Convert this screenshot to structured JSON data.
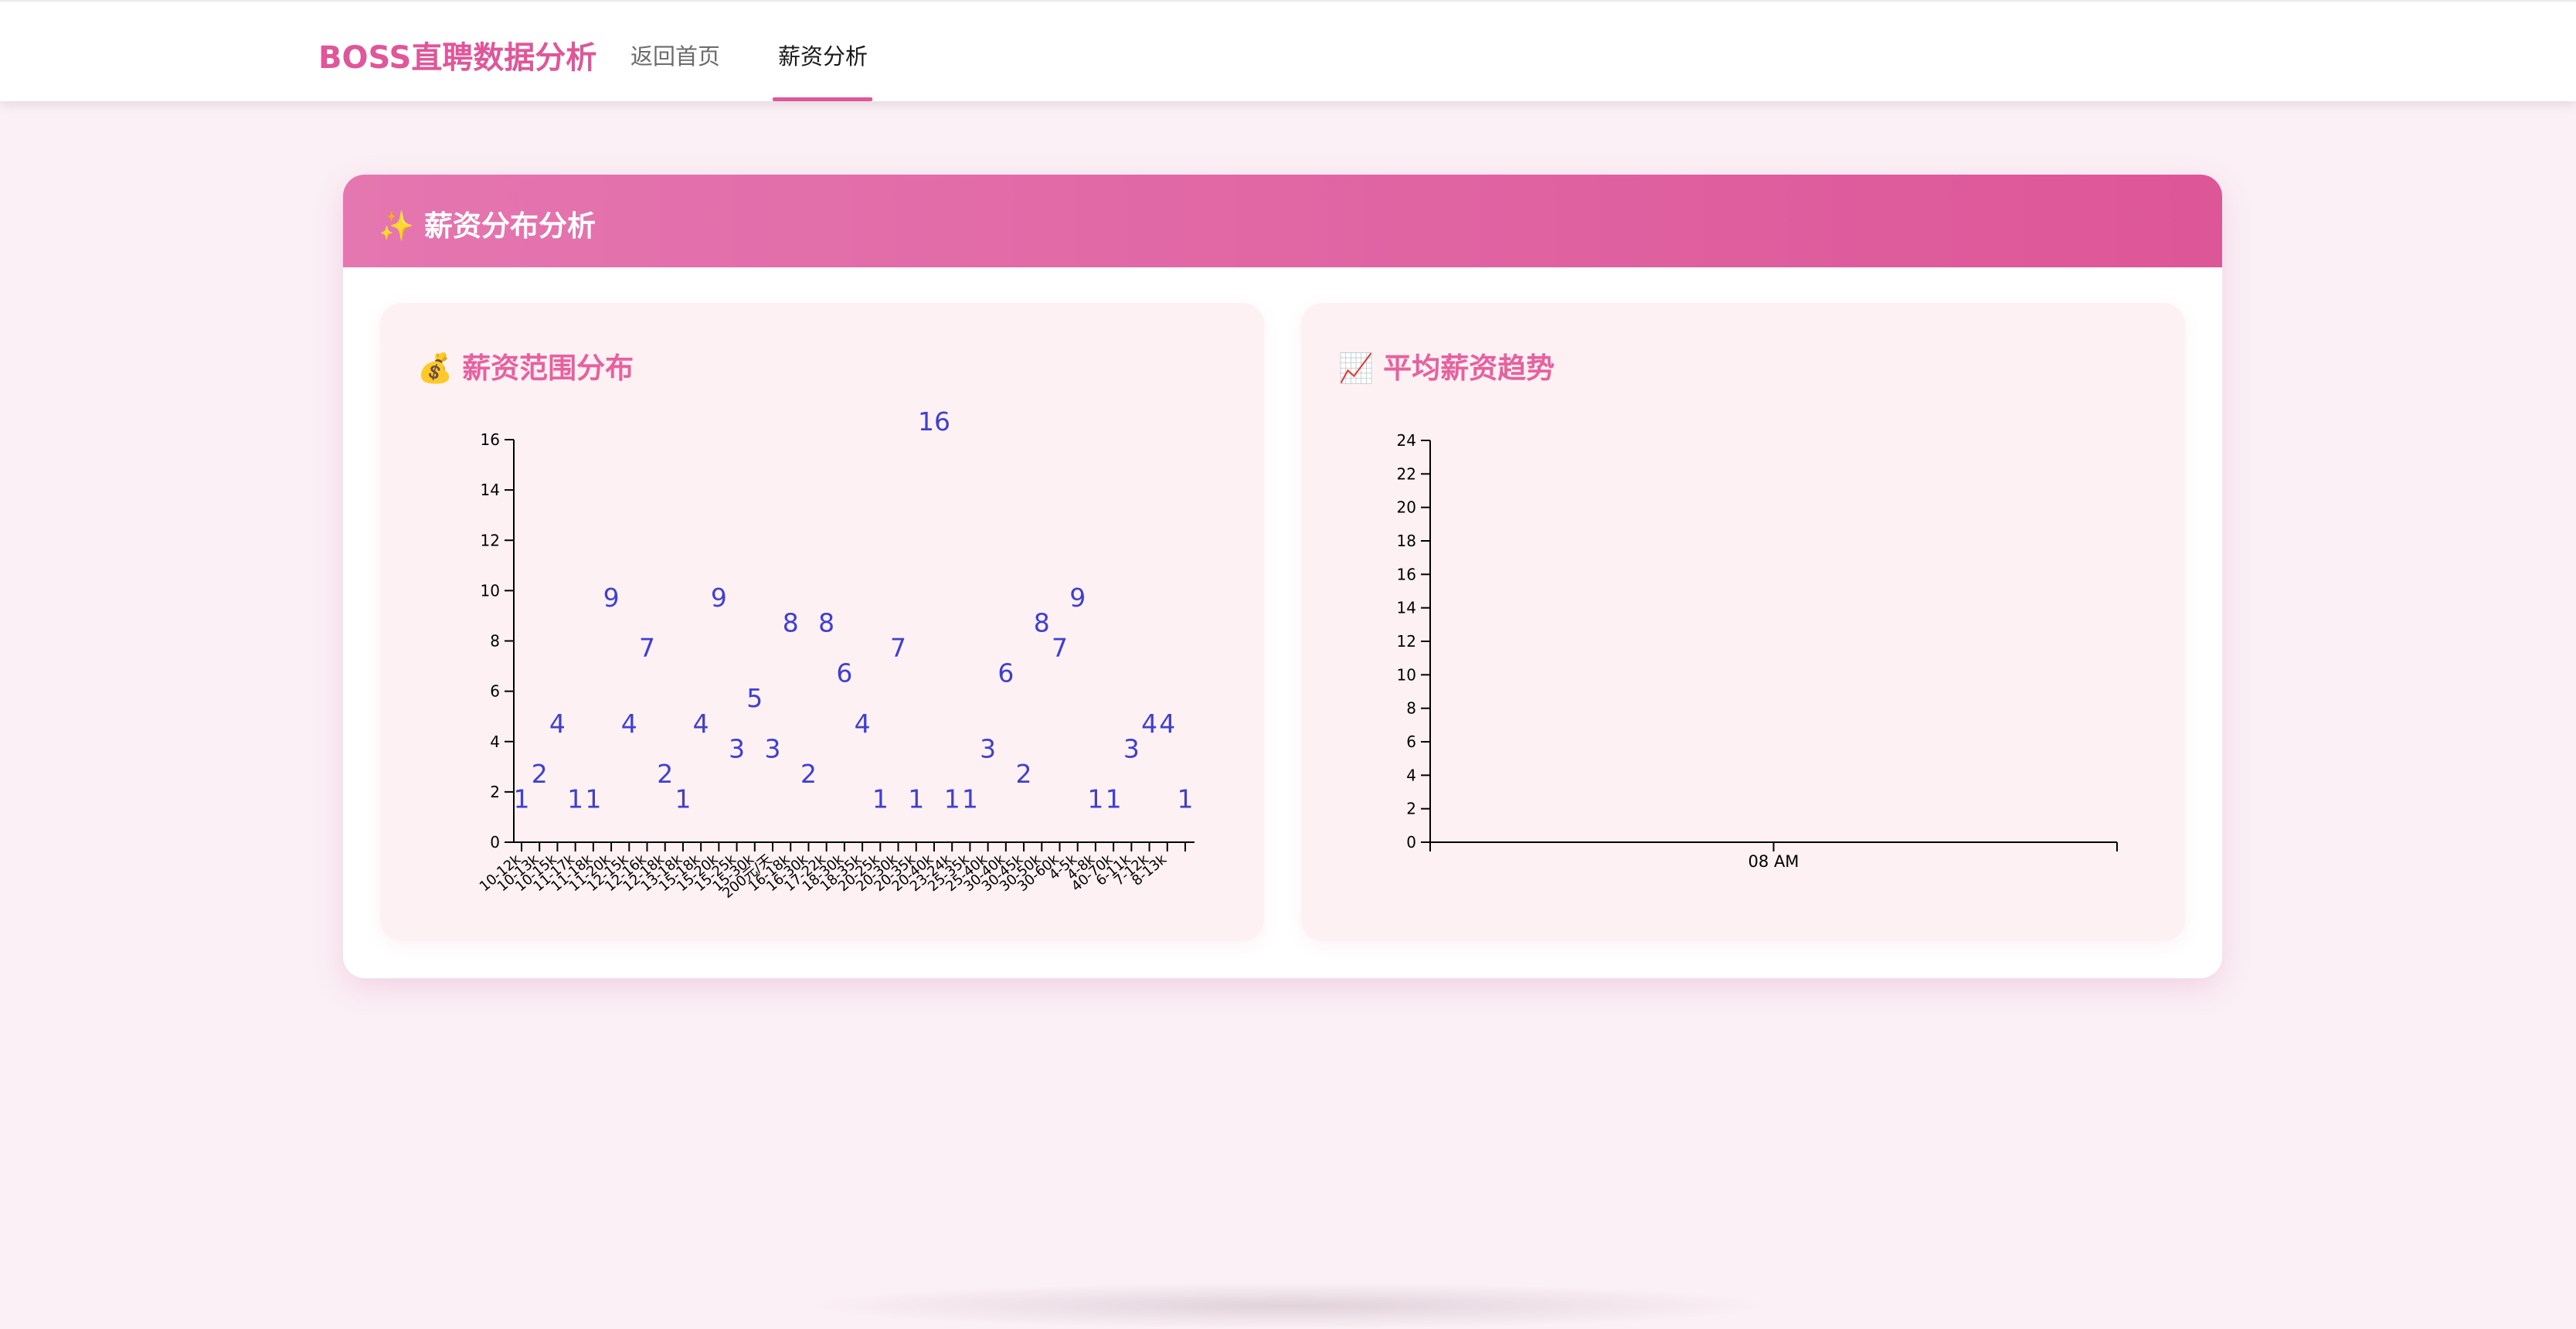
{
  "nav": {
    "brand": "BOSS直聘数据分析",
    "links": [
      {
        "label": "返回首页",
        "active": false
      },
      {
        "label": "薪资分析",
        "active": true
      }
    ],
    "accent_color": "#e0569a"
  },
  "card": {
    "icon": "✨",
    "title": "薪资分布分析"
  },
  "salary_range_panel": {
    "icon": "💰",
    "title": "薪资范围分布"
  },
  "avg_salary_panel": {
    "icon": "📈",
    "title": "平均薪资趋势"
  },
  "chart_data": [
    {
      "type": "scatter",
      "title": "薪资范围分布",
      "marker": "text-count",
      "marker_color": "#3f3fd0",
      "ylim": [
        0,
        16
      ],
      "yticks": [
        0,
        2,
        4,
        6,
        8,
        10,
        12,
        14,
        16
      ],
      "categories": [
        "10-12k",
        "10-13k",
        "10-15k",
        "11-17k",
        "11-18k",
        "11-20k",
        "12-15k",
        "12-16k",
        "12-18k",
        "13-18k",
        "15-18k",
        "15-20k",
        "15-25k",
        "15-30k",
        "200元/天",
        "16-18k",
        "16-30k",
        "17-22k",
        "18-30k",
        "18-35k",
        "20-25k",
        "20-30k",
        "20-35k",
        "20-40k",
        "23-24k",
        "25-35k",
        "25-40k",
        "30-40k",
        "30-45k",
        "30-50k",
        "30-60k",
        "4-5k",
        "4-8k",
        "40-70k",
        "6-11k",
        "7-12k",
        "8-13k"
      ],
      "values": [
        1,
        2,
        4,
        1,
        1,
        9,
        4,
        7,
        2,
        1,
        4,
        9,
        3,
        5,
        3,
        8,
        2,
        8,
        6,
        4,
        1,
        7,
        1,
        16,
        1,
        1,
        3,
        6,
        2,
        8,
        7,
        9,
        1,
        1,
        3,
        4,
        4,
        1
      ]
    },
    {
      "type": "line",
      "title": "平均薪资趋势",
      "ylim": [
        0,
        24
      ],
      "yticks": [
        0,
        2,
        4,
        6,
        8,
        10,
        12,
        14,
        16,
        18,
        20,
        22,
        24
      ],
      "xticks": [
        "08 AM"
      ],
      "series": []
    }
  ]
}
